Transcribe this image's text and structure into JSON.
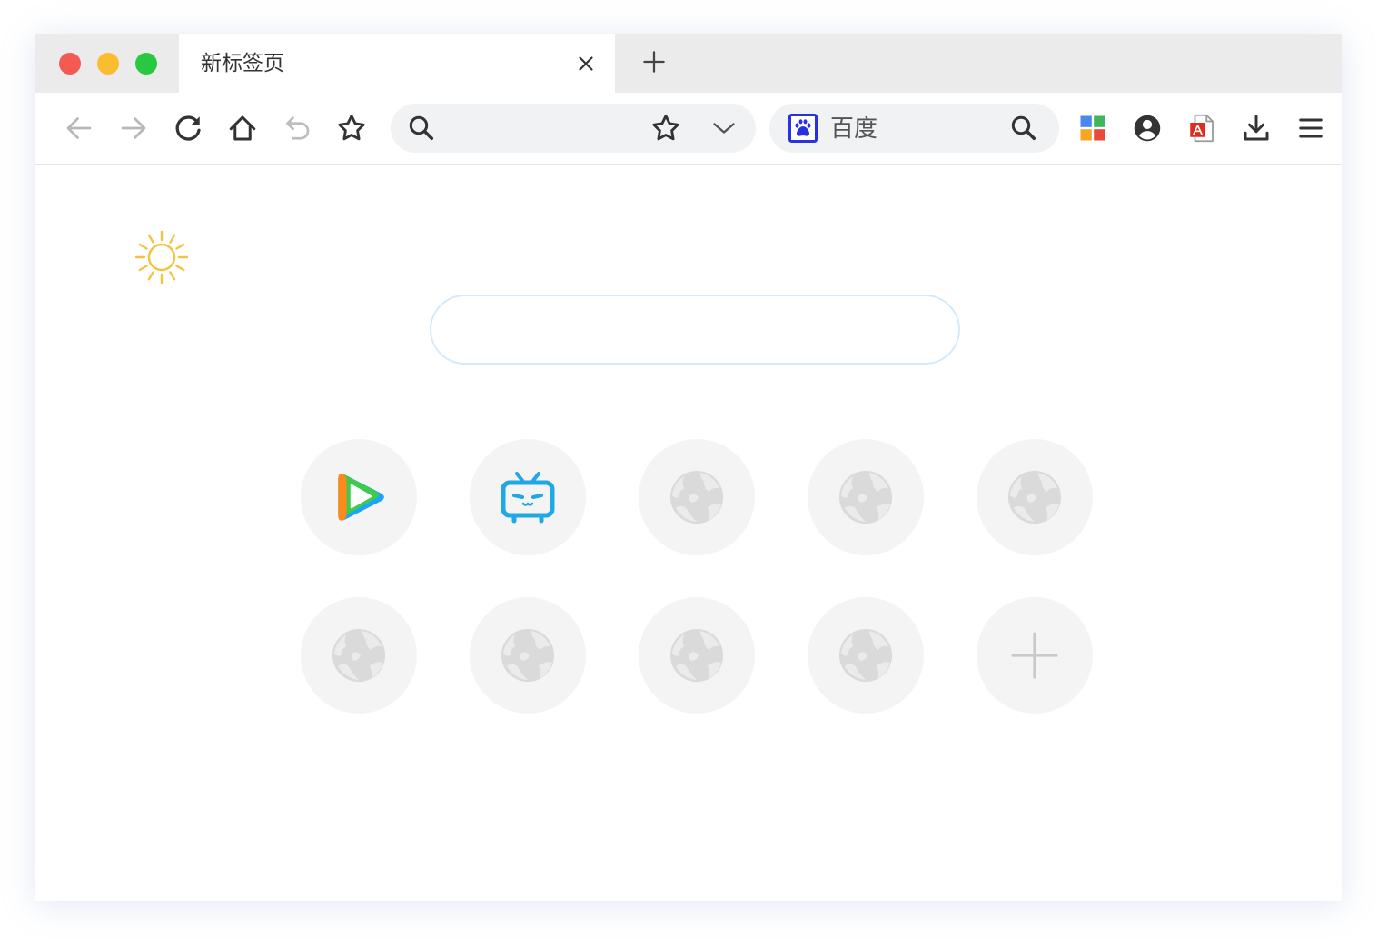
{
  "window": {
    "traffic_lights": [
      {
        "role": "close",
        "color": "#f25a52"
      },
      {
        "role": "minimize",
        "color": "#f9bd2f"
      },
      {
        "role": "maximize",
        "color": "#29c840"
      }
    ]
  },
  "tabs": [
    {
      "title": "新标签页",
      "active": true,
      "close_icon": "close-icon"
    }
  ],
  "new_tab_icon": "plus-icon",
  "toolbar": {
    "nav_icons": [
      {
        "icon": "back-icon",
        "enabled": false
      },
      {
        "icon": "forward-icon",
        "enabled": false
      },
      {
        "icon": "reload-icon",
        "enabled": true
      },
      {
        "icon": "home-icon",
        "enabled": true
      },
      {
        "icon": "undo-close-tab-icon",
        "enabled": false
      },
      {
        "icon": "bookmark-star-icon",
        "enabled": true
      }
    ],
    "address_bar": {
      "value": "",
      "placeholder": "",
      "leading_icon": "search-icon",
      "trailing_icons": [
        "star-icon",
        "chevron-down-icon"
      ]
    },
    "search_engine": {
      "name": "百度",
      "logo_icon": "baidu-paw-icon",
      "logo_color": "#2932e1",
      "search_icon": "search-icon"
    },
    "extension_icons": [
      "apps-grid-icon",
      "account-icon",
      "pdf-icon",
      "download-icon",
      "menu-icon"
    ]
  },
  "new_tab_page": {
    "weather_icon": "sun-icon",
    "weather_icon_color": "#f3c441",
    "search_box": {
      "value": "",
      "placeholder": ""
    },
    "speed_dial": [
      {
        "icon": "tencent-video-icon"
      },
      {
        "icon": "bilibili-icon"
      },
      {
        "icon": "globe-icon"
      },
      {
        "icon": "globe-icon"
      },
      {
        "icon": "globe-icon"
      },
      {
        "icon": "globe-icon"
      },
      {
        "icon": "globe-icon"
      },
      {
        "icon": "globe-icon"
      },
      {
        "icon": "globe-icon"
      },
      {
        "icon": "add-shortcut-plus-icon"
      }
    ]
  },
  "colors": {
    "tab_bar_bg": "#ebebeb",
    "address_bar_bg": "#f1f2f4",
    "search_box_border": "#d4eafb",
    "tile_bg": "#f4f4f5",
    "globe": "#dadada"
  }
}
